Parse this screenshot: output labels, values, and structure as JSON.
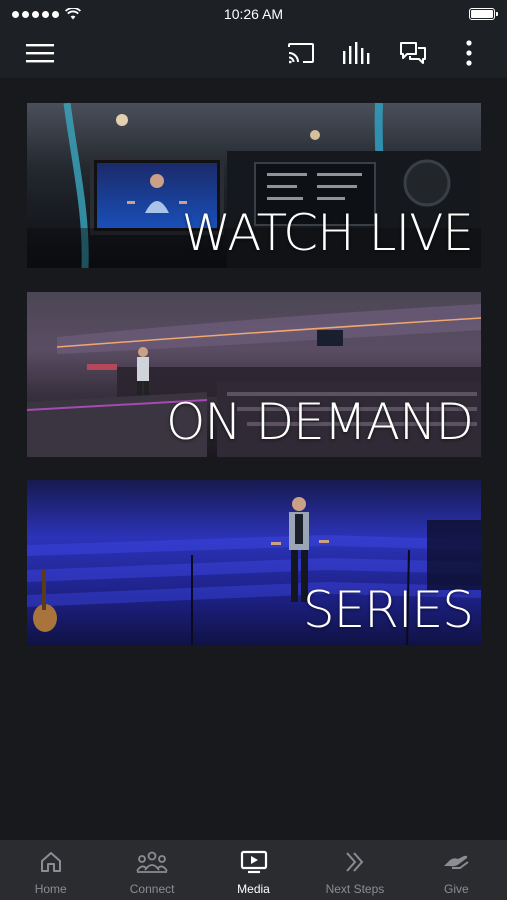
{
  "status_bar": {
    "time": "10:26 AM"
  },
  "app_bar": {
    "menu_icon": "hamburger-menu-icon",
    "actions": [
      "cast-icon",
      "audio-bars-icon",
      "chat-icon",
      "more-vertical-icon"
    ]
  },
  "banners": [
    {
      "label": "WATCH LIVE"
    },
    {
      "label": "ON DEMAND"
    },
    {
      "label": "SERIES"
    }
  ],
  "bottom_nav": {
    "items": [
      {
        "label": "Home",
        "icon": "home-icon",
        "active": false
      },
      {
        "label": "Connect",
        "icon": "people-icon",
        "active": false
      },
      {
        "label": "Media",
        "icon": "media-icon",
        "active": true
      },
      {
        "label": "Next Steps",
        "icon": "chevrons-right-icon",
        "active": false
      },
      {
        "label": "Give",
        "icon": "give-hand-icon",
        "active": false
      }
    ]
  },
  "colors": {
    "background": "#17191c",
    "bar": "#1d2024",
    "nav_background": "#2a2c30",
    "nav_inactive": "#8a8d92",
    "nav_active": "#ffffff"
  }
}
